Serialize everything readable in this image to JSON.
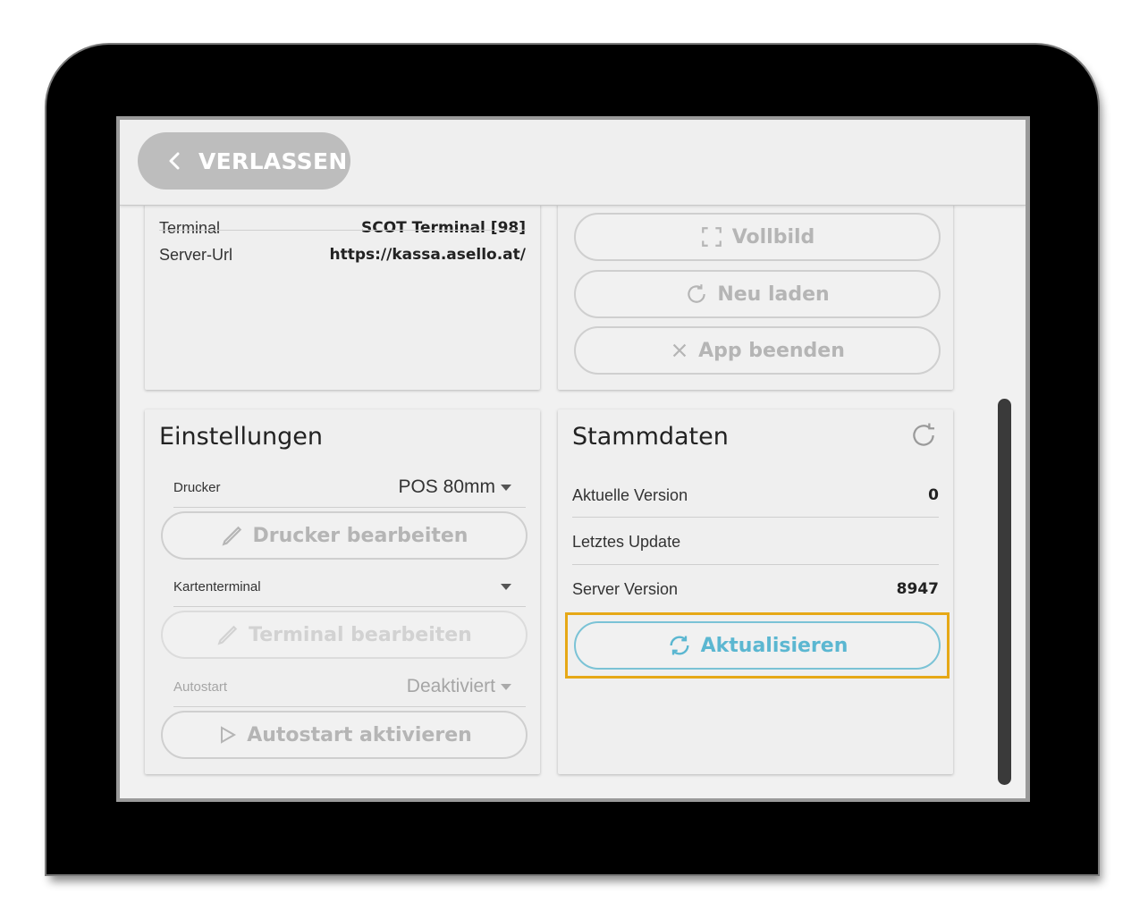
{
  "header": {
    "back_label": "VERLASSEN"
  },
  "info": {
    "rows": [
      {
        "label": "Terminal",
        "value": "SCOT Terminal [98]"
      },
      {
        "label": "Server-Url",
        "value": "https://kassa.asello.at/"
      }
    ]
  },
  "actions": {
    "fullscreen_label": "Vollbild",
    "reload_label": "Neu laden",
    "quit_label": "App beenden"
  },
  "settings": {
    "title": "Einstellungen",
    "printer_label": "Drucker",
    "printer_value": "POS 80mm",
    "printer_edit_label": "Drucker bearbeiten",
    "card_terminal_label": "Kartenterminal",
    "card_terminal_value": "",
    "terminal_edit_label": "Terminal bearbeiten",
    "autostart_label": "Autostart",
    "autostart_value": "Deaktiviert",
    "autostart_button_label": "Autostart aktivieren"
  },
  "masterdata": {
    "title": "Stammdaten",
    "rows": [
      {
        "label": "Aktuelle Version",
        "value": "0"
      },
      {
        "label": "Letztes Update",
        "value": ""
      },
      {
        "label": "Server Version",
        "value": "8947"
      }
    ],
    "update_label": "Aktualisieren"
  },
  "colors": {
    "highlight": "#e6a817",
    "primary": "#5bb7d1",
    "disabled_text": "#b5b5b5"
  }
}
